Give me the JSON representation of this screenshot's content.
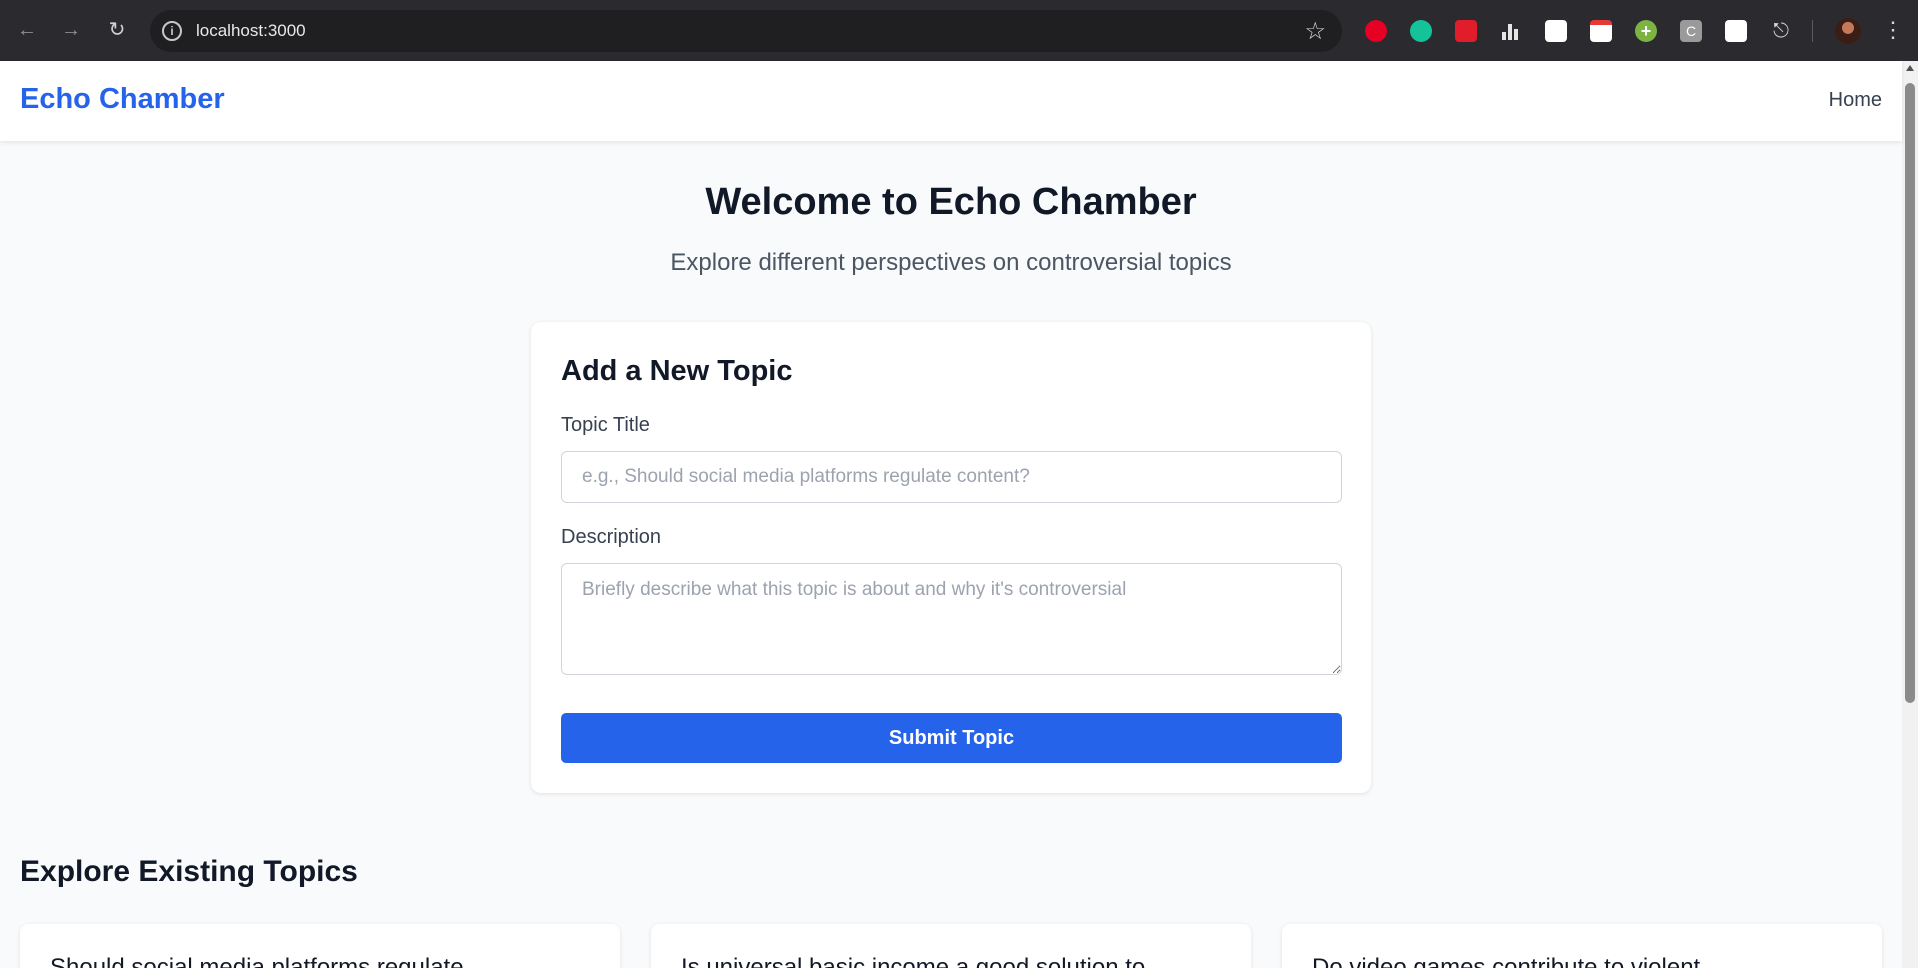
{
  "browser": {
    "url": "localhost:3000",
    "extensions": [
      "pinterest-icon",
      "grammarly-icon",
      "pdf-icon",
      "bars-icon",
      "flag-icon",
      "calendar-icon",
      "plus-icon",
      "c-icon",
      "chart-icon",
      "puzzle-icon"
    ]
  },
  "header": {
    "brand": "Echo Chamber",
    "nav_home": "Home"
  },
  "hero": {
    "title": "Welcome to Echo Chamber",
    "subtitle": "Explore different perspectives on controversial topics"
  },
  "form": {
    "title": "Add a New Topic",
    "topic_title_label": "Topic Title",
    "topic_title_placeholder": "e.g., Should social media platforms regulate content?",
    "topic_title_value": "",
    "description_label": "Description",
    "description_placeholder": "Briefly describe what this topic is about and why it's controversial",
    "description_value": "",
    "submit_label": "Submit Topic"
  },
  "topics": {
    "section_title": "Explore Existing Topics",
    "items": [
      {
        "title": "Should social media platforms regulate"
      },
      {
        "title": "Is universal basic income a good solution to"
      },
      {
        "title": "Do video games contribute to violent"
      }
    ]
  },
  "colors": {
    "accent": "#2563eb",
    "page_bg": "#f9fafb",
    "card_bg": "#ffffff"
  }
}
